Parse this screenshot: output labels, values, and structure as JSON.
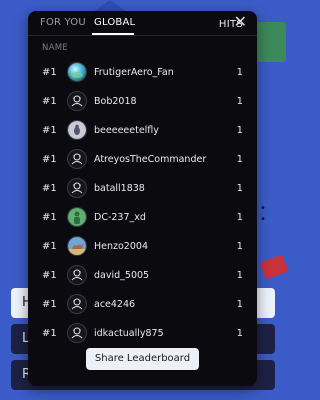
{
  "tabs": [
    {
      "label": "FOR YOU",
      "active": false
    },
    {
      "label": "GLOBAL",
      "active": true
    }
  ],
  "columns": {
    "name": "NAME",
    "hits": "HITS"
  },
  "rows": [
    {
      "rank": "#1",
      "name": "FrutigerAero_Fan",
      "hits": "1",
      "avatar": "aero-orb"
    },
    {
      "rank": "#1",
      "name": "Bob2018",
      "hits": "1",
      "avatar": "default"
    },
    {
      "rank": "#1",
      "name": "beeeeeetelfly",
      "hits": "1",
      "avatar": "bug"
    },
    {
      "rank": "#1",
      "name": "AtreyosTheCommander",
      "hits": "1",
      "avatar": "default"
    },
    {
      "rank": "#1",
      "name": "batall1838",
      "hits": "1",
      "avatar": "default"
    },
    {
      "rank": "#1",
      "name": "DC-237_xd",
      "hits": "1",
      "avatar": "green-figure"
    },
    {
      "rank": "#1",
      "name": "Henzo2004",
      "hits": "1",
      "avatar": "camel"
    },
    {
      "rank": "#1",
      "name": "david_5005",
      "hits": "1",
      "avatar": "default"
    },
    {
      "rank": "#1",
      "name": "ace4246",
      "hits": "1",
      "avatar": "default"
    },
    {
      "rank": "#1",
      "name": "idkactually875",
      "hits": "1",
      "avatar": "default"
    }
  ],
  "share_label": "Share Leaderboard",
  "background_buttons": [
    {
      "label": "H"
    },
    {
      "label": "L"
    },
    {
      "label": "R"
    }
  ],
  "colors": {
    "modal_bg": "#0b0b0f",
    "page_bg": "#3b5cc8",
    "text": "#e8e8ee",
    "muted": "#7c7c85",
    "button_bg": "#eef0f7"
  }
}
